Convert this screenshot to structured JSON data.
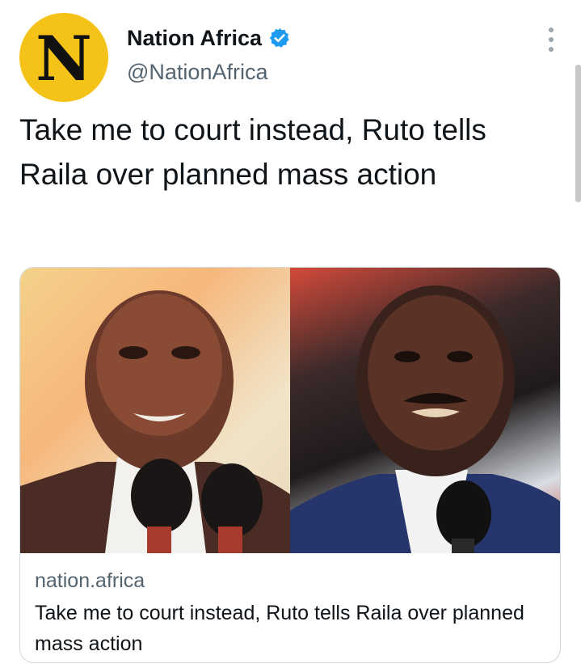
{
  "author": {
    "avatar_letter": "N",
    "display_name": "Nation Africa",
    "handle": "@NationAfrica",
    "verified": true
  },
  "tweet": {
    "text": "Take me to court instead, Ruto tells Raila over planned mass action"
  },
  "card": {
    "domain": "nation.africa",
    "title": "Take me to court instead, Ruto tells Raila over planned mass action"
  },
  "icons": {
    "verified": "verified-badge-icon",
    "more": "more-options-icon"
  },
  "colors": {
    "avatar_bg": "#f5c218",
    "verified": "#1d9bf0",
    "secondary_text": "#536471"
  }
}
